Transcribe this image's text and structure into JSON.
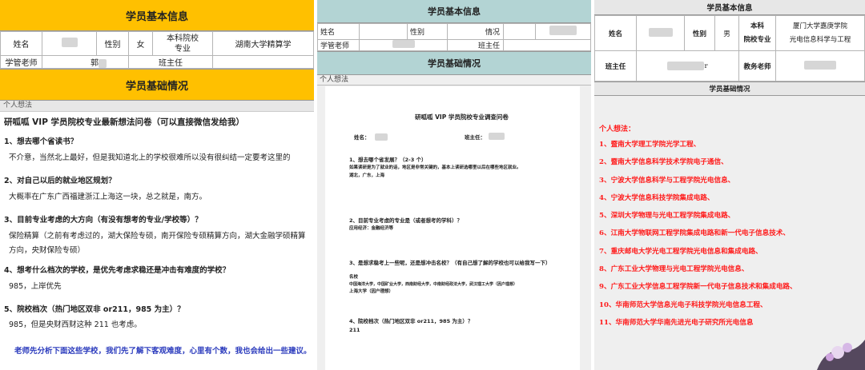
{
  "panel1": {
    "title": "学员基本信息",
    "row1": {
      "name_label": "姓名",
      "gender_label": "性别",
      "gender_value": "女",
      "school_label": "本科院校\n专业",
      "school_value": "湖南大学精算学"
    },
    "row2": {
      "advisor_label": "学管老师",
      "advisor_value": "郭",
      "headteacher_label": "班主任"
    },
    "section_title": "学员基础情况",
    "thoughts_label": "个人想法",
    "doc_title": "研呱呱 VIP 学员院校专业最新想法问卷（可以直接微信发给我）",
    "qa": [
      {
        "q": "1、想去哪个省读书？",
        "a": "不介意，当然北上最好，但是我知道北上的学校很难所以没有很纠结一定要考这里的"
      },
      {
        "q": "2、对自己以后的就业地区规划？",
        "a": "大概率在广东广西福建浙江上海这一块，总之就是，南方。"
      },
      {
        "q": "3、目前专业考虑的大方向（有没有想考的专业/学校等）？",
        "a": "保险精算（之前有考虑过的，湖大保险专硕，南开保险专硕精算方向，湖大金融学硕精算方向，央财保险专硕）"
      },
      {
        "q": "4、想考什么档次的学校，是优先考虑求稳还是冲击有难度的学校？",
        "a": "985，上岸优先"
      },
      {
        "q": "5、院校档次（热门地区双非 or211，985 为主）？",
        "a": "985，但是央财西财这种 211 也考虑。"
      }
    ],
    "footer": "老师先分析下面这些学校，我们先了解下客观难度，心里有个数，我也会给出一些建议。"
  },
  "panel2": {
    "title": "学员基本信息",
    "row1": {
      "name_label": "姓名",
      "gender_label": "性别",
      "status_label": "情况"
    },
    "row2": {
      "advisor_label": "学管老师",
      "headteacher_label": "班主任"
    },
    "section_title": "学员基础情况",
    "thoughts_label": "个人想法",
    "doc": {
      "title": "研呱呱 VIP 学员院校专业调查问卷",
      "name_label": "姓名：",
      "headteacher_label": "班主任：",
      "q1": "1、想去哪个省发展？（2-3 个）",
      "q1_note": "如果读研是为了就业的话，地区是非常关键的，基本上读研选哪里以后在哪些地区就业。",
      "q1_answer": "湖北，广东，上海",
      "q2": "2、目前专业考虑的专业是（或者想考的学科）？",
      "q2_answer": "应用经济：金融经济等",
      "q3": "3、是想求稳考上一些呢，还是想冲击名校？（有自己想了解的学校也可以给我写一下）",
      "q3_answer_label": "名校",
      "q3_answer1": "中国海洋大学，中国矿业大学，西南财经大学，中南财经政法大学，武汉理工大学（因户理想）",
      "q3_answer2": "上海大学（因户理想）",
      "q4": "4、院校档次（热门地区双非 or211，985 为主）？",
      "q4_answer": "211"
    }
  },
  "panel3": {
    "title": "学员基本信息",
    "row1": {
      "name_label": "姓名",
      "gender_label": "性别",
      "gender_value": "男",
      "school_label": "本科\n院校专业",
      "school_value1": "厦门大学嘉庚学院",
      "school_value2": "光电信息科学与工程"
    },
    "row2": {
      "headteacher_label": "班主任",
      "headteacher_suffix": "r",
      "teacher_label": "教务老师"
    },
    "section_title": "学员基础情况",
    "thoughts_label": "个人想法：",
    "items": [
      "1、暨南大学理工学院光学工程、",
      "2、暨南大学信息科学技术学院电子通信、",
      "3、宁波大学信息科学与工程学院光电信息、",
      "4、宁波大学信息科技学院集成电路、",
      "5、深圳大学物理与光电工程学院集成电路、",
      "6、江南大学物联网工程学院集成电路和新一代电子信息技术、",
      "7、重庆邮电大学光电工程学院光电信息和集成电路、",
      "8、广东工业大学物理与光电工程学院光电信息、",
      "9、广东工业大学信息工程学院新一代电子信息技术和集成电路、",
      "10、华南师范大学信息光电子科技学院光电信息工程、",
      "11、华南师范大学华南先进光电子研究所光电信息"
    ]
  },
  "colors": {
    "orange": "#ffc000",
    "teal": "#b3d4d4",
    "gray": "#e7e7e7",
    "red": "#ff1a1a",
    "blue": "#2b3bbd"
  }
}
